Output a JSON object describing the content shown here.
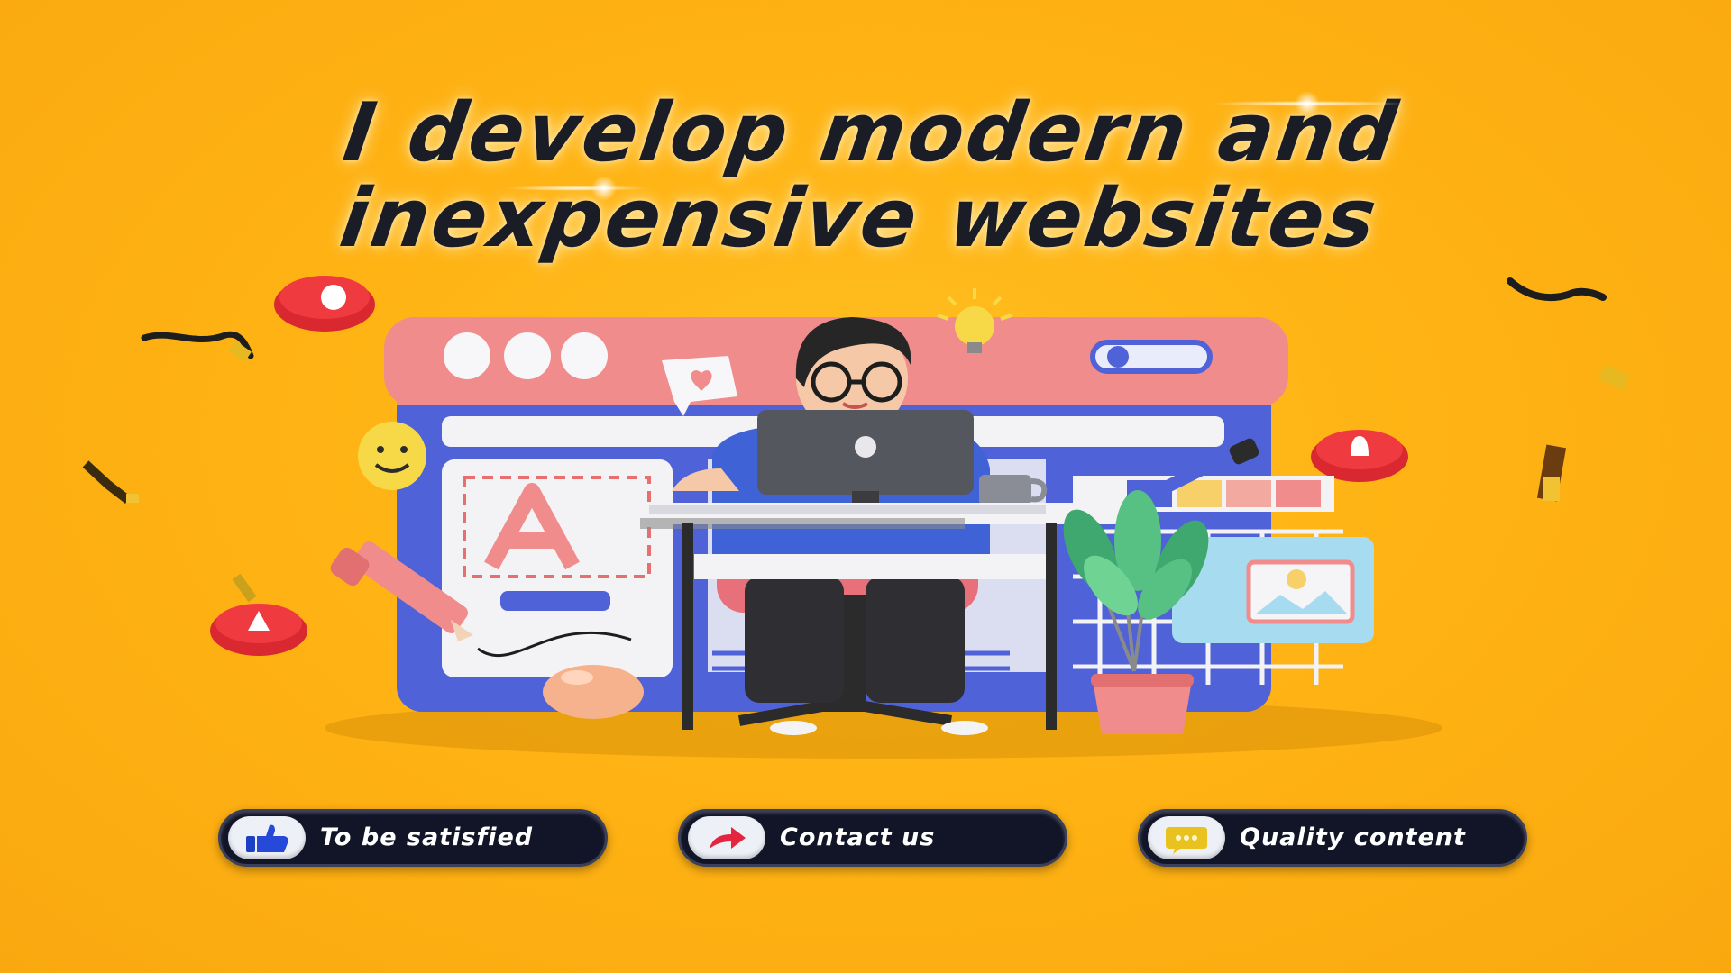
{
  "headline": {
    "line1": "I develop modern and",
    "line2": "inexpensive websites"
  },
  "buttons": [
    {
      "label": "To be satisfied",
      "icon": "thumbs-up-icon"
    },
    {
      "label": "Contact us",
      "icon": "arrow-right-icon"
    },
    {
      "label": "Quality content",
      "icon": "chat-bubble-icon"
    }
  ],
  "colors": {
    "background": "#ffb314",
    "headline": "#1a1d26",
    "pill": "#121528",
    "window_frame": "#f08c8c",
    "window_body": "#4f62d8"
  }
}
